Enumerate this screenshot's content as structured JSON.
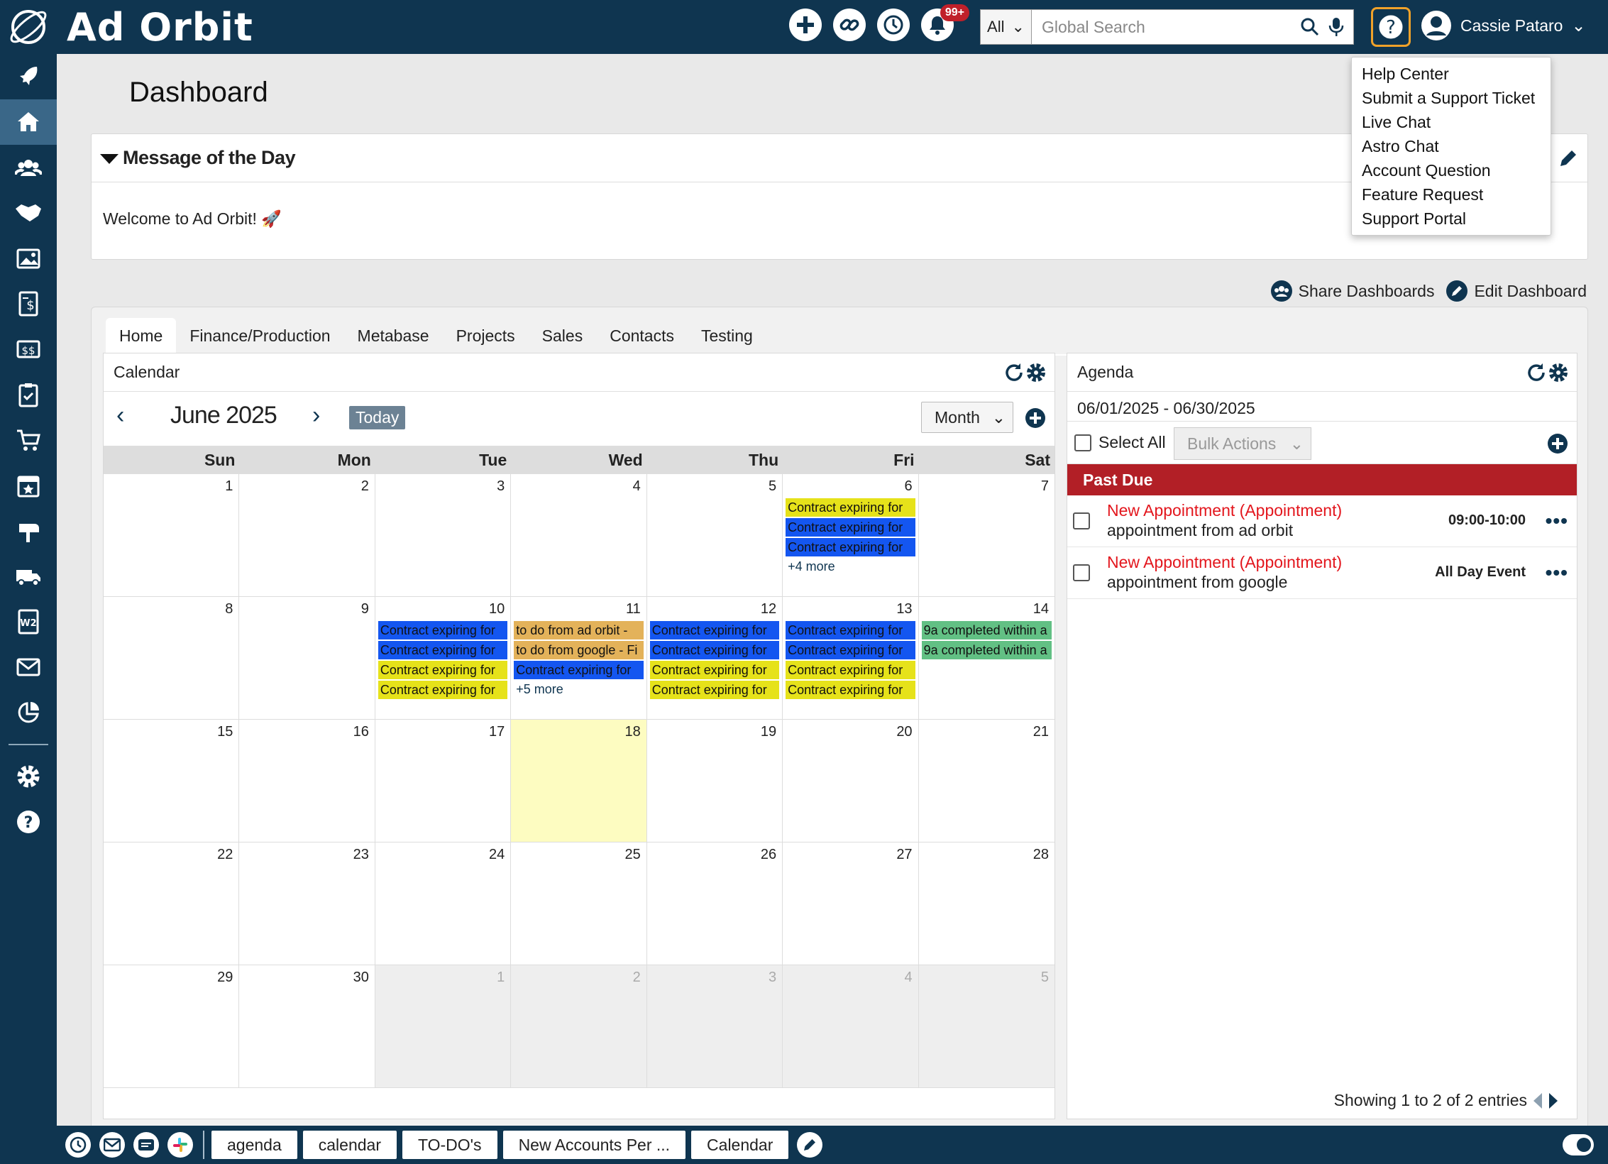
{
  "app": {
    "brand": "Ad Orbit",
    "brand_color": "#0f3550",
    "accent": "#f0a22a"
  },
  "header": {
    "notification_count": "99+",
    "search_scope": "All",
    "search_placeholder": "Global Search",
    "user_name": "Cassie Pataro"
  },
  "help_menu": {
    "items": [
      "Help Center",
      "Submit a Support Ticket",
      "Live Chat",
      "Astro Chat",
      "Account Question",
      "Feature Request",
      "Support Portal"
    ]
  },
  "sidebar": {
    "items": [
      "rocket-icon",
      "home-icon",
      "contacts-icon",
      "handshake-icon",
      "media-icon",
      "invoice-icon",
      "finance-icon",
      "clipboard-icon",
      "cart-icon",
      "calendar-star-icon",
      "mailbox-icon",
      "truck-icon",
      "w2-icon",
      "mail-icon",
      "chart-icon",
      "gear-icon",
      "help-icon"
    ]
  },
  "page": {
    "title": "Dashboard"
  },
  "motd": {
    "title": "Message of the Day",
    "body": "Welcome to Ad Orbit! 🚀"
  },
  "dashboard_actions": {
    "share": "Share Dashboards",
    "edit": "Edit Dashboard"
  },
  "tabs": [
    "Home",
    "Finance/Production",
    "Metabase",
    "Projects",
    "Sales",
    "Contacts",
    "Testing"
  ],
  "calendar": {
    "title": "Calendar",
    "month_label": "June 2025",
    "today_label": "Today",
    "view": "Month",
    "weekdays": [
      "Sun",
      "Mon",
      "Tue",
      "Wed",
      "Thu",
      "Fri",
      "Sat"
    ],
    "days": [
      {
        "n": "1"
      },
      {
        "n": "2"
      },
      {
        "n": "3"
      },
      {
        "n": "4"
      },
      {
        "n": "5"
      },
      {
        "n": "6",
        "events": [
          {
            "t": "Contract expiring for",
            "c": "yellow"
          },
          {
            "t": "Contract expiring for",
            "c": "blue"
          },
          {
            "t": "Contract expiring for",
            "c": "blue"
          }
        ],
        "more": "+4 more"
      },
      {
        "n": "7"
      },
      {
        "n": "8"
      },
      {
        "n": "9"
      },
      {
        "n": "10",
        "events": [
          {
            "t": "Contract expiring for",
            "c": "blue"
          },
          {
            "t": "Contract expiring for",
            "c": "blue"
          },
          {
            "t": "Contract expiring for",
            "c": "yellow"
          },
          {
            "t": "Contract expiring for",
            "c": "yellow"
          }
        ]
      },
      {
        "n": "11",
        "events": [
          {
            "t": "to do from ad orbit -",
            "c": "orange"
          },
          {
            "t": "to do from google - Fi",
            "c": "orange"
          },
          {
            "t": "Contract expiring for",
            "c": "blue"
          }
        ],
        "more": "+5 more"
      },
      {
        "n": "12",
        "events": [
          {
            "t": "Contract expiring for",
            "c": "blue"
          },
          {
            "t": "Contract expiring for",
            "c": "blue"
          },
          {
            "t": "Contract expiring for",
            "c": "yellow"
          },
          {
            "t": "Contract expiring for",
            "c": "yellow"
          }
        ]
      },
      {
        "n": "13",
        "events": [
          {
            "t": "Contract expiring for",
            "c": "blue"
          },
          {
            "t": "Contract expiring for",
            "c": "blue"
          },
          {
            "t": "Contract expiring for",
            "c": "yellow"
          },
          {
            "t": "Contract expiring for",
            "c": "yellow"
          }
        ]
      },
      {
        "n": "14",
        "events": [
          {
            "t": "9a completed within a",
            "c": "green"
          },
          {
            "t": "9a completed within a",
            "c": "green"
          }
        ]
      },
      {
        "n": "15"
      },
      {
        "n": "16"
      },
      {
        "n": "17"
      },
      {
        "n": "18",
        "today": true
      },
      {
        "n": "19"
      },
      {
        "n": "20"
      },
      {
        "n": "21"
      },
      {
        "n": "22"
      },
      {
        "n": "23"
      },
      {
        "n": "24"
      },
      {
        "n": "25"
      },
      {
        "n": "26"
      },
      {
        "n": "27"
      },
      {
        "n": "28"
      },
      {
        "n": "29"
      },
      {
        "n": "30"
      },
      {
        "n": "1",
        "other": true
      },
      {
        "n": "2",
        "other": true
      },
      {
        "n": "3",
        "other": true
      },
      {
        "n": "4",
        "other": true
      },
      {
        "n": "5",
        "other": true
      }
    ]
  },
  "agenda": {
    "title": "Agenda",
    "range": "06/01/2025 - 06/30/2025",
    "select_all": "Select All",
    "bulk_actions": "Bulk Actions",
    "section": "Past Due",
    "rows": [
      {
        "title": "New Appointment (Appointment)",
        "sub": "appointment from ad orbit",
        "time": "09:00-10:00"
      },
      {
        "title": "New Appointment (Appointment)",
        "sub": "appointment from google",
        "time": "All Day Event"
      }
    ],
    "footer": "Showing 1 to 2 of 2 entries"
  },
  "bottom_bar": {
    "tabs": [
      "agenda",
      "calendar",
      "TO-DO's",
      "New Accounts Per ...",
      "Calendar"
    ]
  }
}
